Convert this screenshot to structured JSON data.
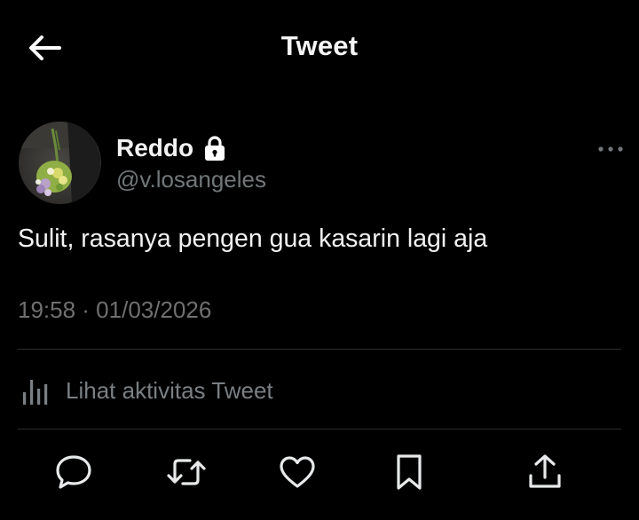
{
  "header": {
    "title": "Tweet",
    "back_icon": "back-arrow-icon"
  },
  "author": {
    "display_name": "Reddo",
    "handle": "@v.losangeles",
    "protected_icon": "lock-icon",
    "avatar_icon": "avatar-flower-bouquet"
  },
  "tweet": {
    "text": "Sulit, rasanya pengen gua kasarin lagi aja",
    "timestamp": "19:58 · 01/03/2026",
    "more_icon": "more-icon"
  },
  "activity": {
    "label": "Lihat aktivitas Tweet",
    "icon": "analytics-icon"
  },
  "actions": [
    {
      "name": "reply",
      "icon": "reply-icon"
    },
    {
      "name": "retweet",
      "icon": "retweet-icon"
    },
    {
      "name": "like",
      "icon": "like-icon"
    },
    {
      "name": "bookmark",
      "icon": "bookmark-icon"
    },
    {
      "name": "share",
      "icon": "share-icon"
    }
  ],
  "colors": {
    "background": "#000000",
    "text_primary": "#f2f2f2",
    "text_secondary": "#717779",
    "divider": "#2a2c2f"
  }
}
